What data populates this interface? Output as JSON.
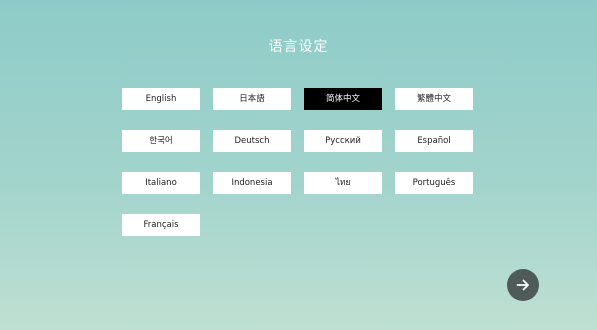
{
  "page": {
    "title": "语言设定"
  },
  "languages": [
    {
      "label": "English",
      "selected": false
    },
    {
      "label": "日本語",
      "selected": false
    },
    {
      "label": "简体中文",
      "selected": true
    },
    {
      "label": "繁體中文",
      "selected": false
    },
    {
      "label": "한국어",
      "selected": false
    },
    {
      "label": "Deutsch",
      "selected": false
    },
    {
      "label": "Русский",
      "selected": false
    },
    {
      "label": "Español",
      "selected": false
    },
    {
      "label": "Italiano",
      "selected": false
    },
    {
      "label": "Indonesia",
      "selected": false
    },
    {
      "label": "ไทย",
      "selected": false
    },
    {
      "label": "Português",
      "selected": false
    },
    {
      "label": "Français",
      "selected": false
    }
  ],
  "next_button": {
    "icon": "arrow-right-icon"
  },
  "colors": {
    "background_top": "#8ecbc8",
    "background_bottom": "#bfe0d2",
    "button_bg": "#ffffff",
    "selected_bg": "#000000",
    "next_button_bg": "#4f5b58"
  }
}
